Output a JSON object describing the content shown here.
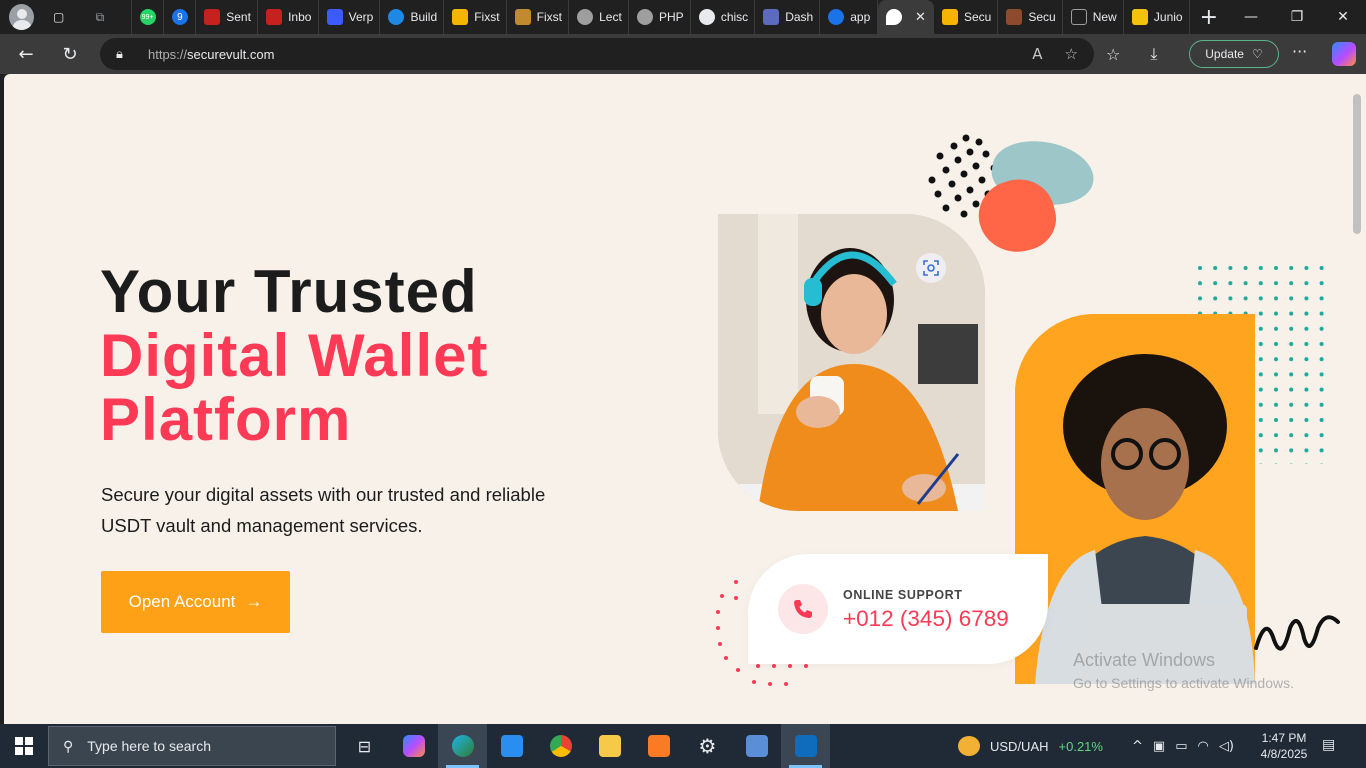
{
  "browser": {
    "url_protocol": "https://",
    "url_host": "securevult.com",
    "update_label": "Update",
    "active_tab_label": "",
    "tabs": [
      {
        "label": "Sent",
        "color": "#c5221f"
      },
      {
        "label": "Inbo",
        "color": "#c5221f"
      },
      {
        "label": "Verp",
        "color": "#3d5afe"
      },
      {
        "label": "Build",
        "color": "#1e88e5"
      },
      {
        "label": "Fixst",
        "color": "#f4b400"
      },
      {
        "label": "Fixst",
        "color": "#c28a2e"
      },
      {
        "label": "Lect",
        "color": "#9e9e9e"
      },
      {
        "label": "PHP",
        "color": "#9e9e9e"
      },
      {
        "label": "chisc",
        "color": "#e8eaed"
      },
      {
        "label": "Dash",
        "color": "#5c6bc0"
      },
      {
        "label": "app",
        "color": "#1a73e8"
      },
      {
        "label": "Secu",
        "color": "#f4b400"
      },
      {
        "label": "Secu",
        "color": "#8e4a2d"
      },
      {
        "label": "New",
        "color": "#9e9e9e"
      },
      {
        "label": "Junio",
        "color": "#f4c20d"
      }
    ],
    "whatsapp_badge": "99+",
    "tab_badge": "9"
  },
  "hero": {
    "line1": "Your Trusted",
    "line2": "Digital Wallet",
    "line3": "Platform",
    "subtitle_line1": "Secure your digital assets with our trusted and reliable",
    "subtitle_line2": "USDT vault and management services.",
    "cta_label": "Open Account",
    "cta_arrow": "→"
  },
  "support": {
    "label": "ONLINE SUPPORT",
    "phone": "+012 (345) 6789"
  },
  "watermark": {
    "line1": "Activate Windows",
    "line2": "Go to Settings to activate Windows."
  },
  "taskbar": {
    "search_placeholder": "Type here to search",
    "ticker": "USD/UAH",
    "ticker_change": "+0.21%",
    "time": "1:47 PM",
    "date": "4/8/2025"
  },
  "colors": {
    "accent_red": "#fd3a55",
    "accent_orange": "#fea116",
    "page_bg": "#f7f1ea"
  }
}
